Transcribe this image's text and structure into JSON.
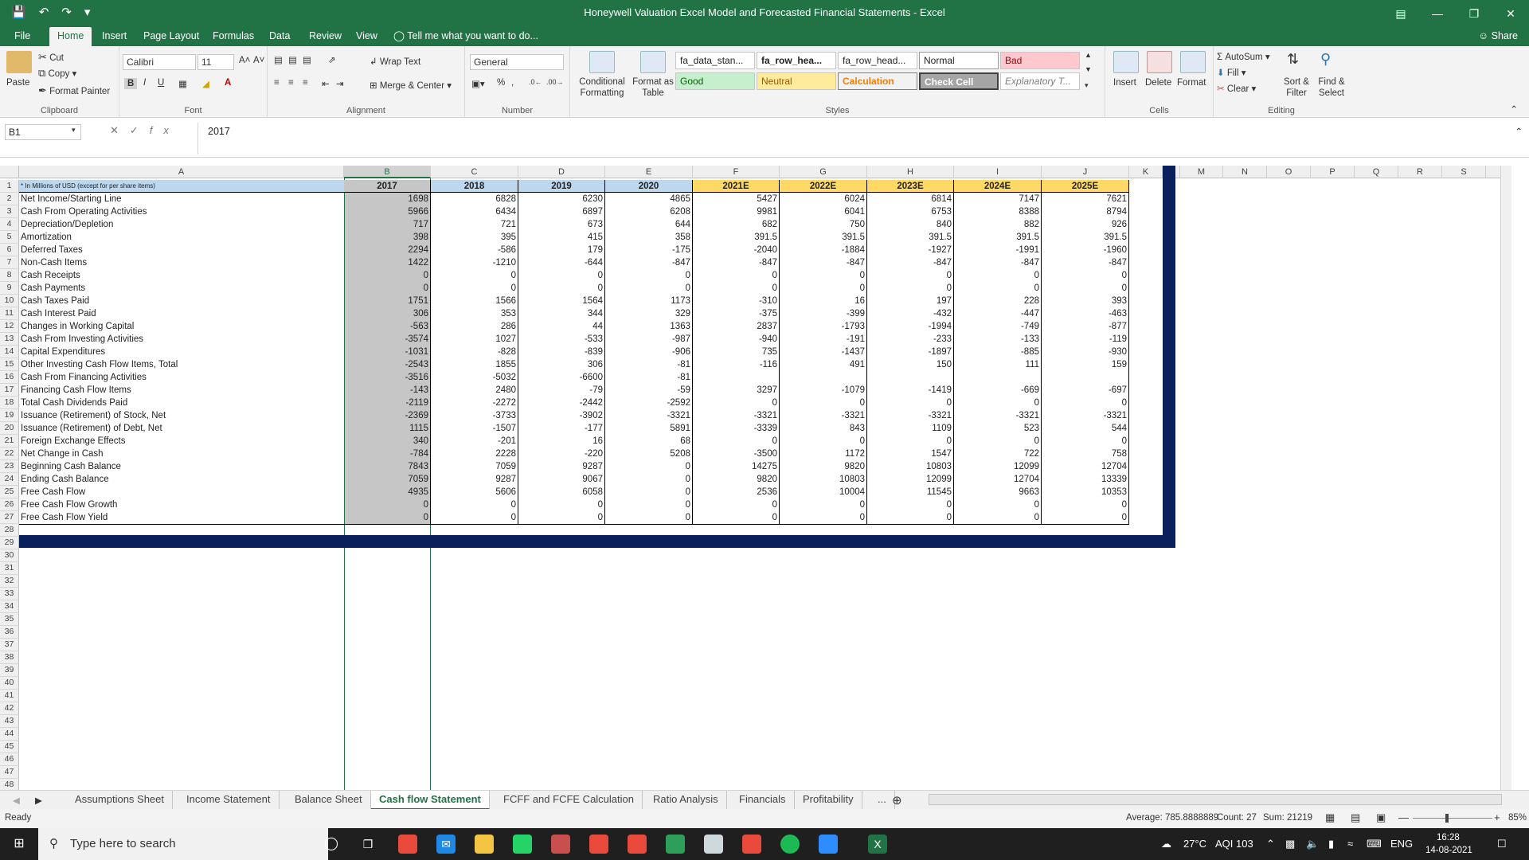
{
  "window": {
    "title": "Honeywell Valuation Excel Model and Forecasted Financial Statements - Excel",
    "qat": [
      "save-icon",
      "undo-icon",
      "redo-icon",
      "customize-icon"
    ],
    "controls": [
      "ribbon-display-icon",
      "minimize-icon",
      "restore-icon",
      "close-icon"
    ]
  },
  "ribbon_tabs": [
    "File",
    "Home",
    "Insert",
    "Page Layout",
    "Formulas",
    "Data",
    "Review",
    "View"
  ],
  "active_tab": "Home",
  "tell_me": "Tell me what you want to do...",
  "share_label": "Share",
  "clipboard": {
    "paste": "Paste",
    "cut": "Cut",
    "copy": "Copy",
    "format_painter": "Format Painter",
    "label": "Clipboard"
  },
  "font": {
    "name": "Calibri",
    "size": "11",
    "label": "Font"
  },
  "alignment": {
    "wrap_text": "Wrap Text",
    "merge_center": "Merge & Center",
    "label": "Alignment"
  },
  "number": {
    "format": "General",
    "label": "Number"
  },
  "styles": {
    "conditional_formatting": "Conditional Formatting",
    "format_as_table": "Format as Table",
    "cells": [
      "fa_data_stan...",
      "fa_row_hea...",
      "fa_row_head...",
      "Normal",
      "Bad",
      "Good",
      "Neutral",
      "Calculation",
      "Check Cell",
      "Explanatory T..."
    ],
    "label": "Styles"
  },
  "cells_group": {
    "insert": "Insert",
    "delete": "Delete",
    "format": "Format",
    "label": "Cells"
  },
  "editing": {
    "autosum": "AutoSum",
    "fill": "Fill",
    "clear": "Clear",
    "sort_filter": "Sort & Filter",
    "find_select": "Find & Select",
    "label": "Editing"
  },
  "formula_bar": {
    "name_box": "B1",
    "content": "2017"
  },
  "columns": [
    "A",
    "B",
    "C",
    "D",
    "E",
    "F",
    "G",
    "H",
    "I",
    "J",
    "K",
    "L",
    "M",
    "N",
    "O",
    "P",
    "Q",
    "R",
    "S",
    "T"
  ],
  "row_numbers": [
    "1",
    "2",
    "3",
    "4",
    "5",
    "6",
    "7",
    "8",
    "9",
    "10",
    "11",
    "12",
    "13",
    "14",
    "15",
    "16",
    "17",
    "18",
    "19",
    "20",
    "21",
    "22",
    "23",
    "24",
    "25",
    "26",
    "27",
    "28",
    "29",
    "30",
    "31",
    "32",
    "33",
    "34",
    "35",
    "36",
    "37",
    "38",
    "39",
    "40",
    "41",
    "42",
    "43",
    "44",
    "45",
    "46",
    "47",
    "48"
  ],
  "sheet": {
    "header_label": "* In Millions of USD (except for per share items)",
    "years": [
      "2017",
      "2018",
      "2019",
      "2020",
      "2021E",
      "2022E",
      "2023E",
      "2024E",
      "2025E"
    ],
    "rows": [
      {
        "label": "Net Income/Starting Line",
        "values": [
          "1698",
          "6828",
          "6230",
          "4865",
          "5427",
          "6024",
          "6814",
          "7147",
          "7621"
        ]
      },
      {
        "label": "Cash From Operating Activities",
        "values": [
          "5966",
          "6434",
          "6897",
          "6208",
          "9981",
          "6041",
          "6753",
          "8388",
          "8794"
        ]
      },
      {
        "label": "Depreciation/Depletion",
        "values": [
          "717",
          "721",
          "673",
          "644",
          "682",
          "750",
          "840",
          "882",
          "926"
        ]
      },
      {
        "label": "Amortization",
        "values": [
          "398",
          "395",
          "415",
          "358",
          "391.5",
          "391.5",
          "391.5",
          "391.5",
          "391.5"
        ]
      },
      {
        "label": "Deferred Taxes",
        "values": [
          "2294",
          "-586",
          "179",
          "-175",
          "-2040",
          "-1884",
          "-1927",
          "-1991",
          "-1960"
        ]
      },
      {
        "label": "Non-Cash Items",
        "values": [
          "1422",
          "-1210",
          "-644",
          "-847",
          "-847",
          "-847",
          "-847",
          "-847",
          "-847"
        ]
      },
      {
        "label": "Cash Receipts",
        "values": [
          "0",
          "0",
          "0",
          "0",
          "0",
          "0",
          "0",
          "0",
          "0"
        ]
      },
      {
        "label": "Cash Payments",
        "values": [
          "0",
          "0",
          "0",
          "0",
          "0",
          "0",
          "0",
          "0",
          "0"
        ]
      },
      {
        "label": "Cash Taxes Paid",
        "values": [
          "1751",
          "1566",
          "1564",
          "1173",
          "-310",
          "16",
          "197",
          "228",
          "393"
        ]
      },
      {
        "label": "Cash Interest Paid",
        "values": [
          "306",
          "353",
          "344",
          "329",
          "-375",
          "-399",
          "-432",
          "-447",
          "-463"
        ]
      },
      {
        "label": "Changes in Working Capital",
        "values": [
          "-563",
          "286",
          "44",
          "1363",
          "2837",
          "-1793",
          "-1994",
          "-749",
          "-877"
        ]
      },
      {
        "label": "Cash From Investing Activities",
        "values": [
          "-3574",
          "1027",
          "-533",
          "-987",
          "-940",
          "-191",
          "-233",
          "-133",
          "-119"
        ]
      },
      {
        "label": "Capital Expenditures",
        "values": [
          "-1031",
          "-828",
          "-839",
          "-906",
          "735",
          "-1437",
          "-1897",
          "-885",
          "-930"
        ]
      },
      {
        "label": "Other Investing Cash Flow Items, Total",
        "values": [
          "-2543",
          "1855",
          "306",
          "-81",
          "-116",
          "491",
          "150",
          "111",
          "159"
        ]
      },
      {
        "label": "Cash From Financing Activities",
        "values": [
          "-3516",
          "-5032",
          "-6600",
          "-81",
          "",
          "",
          "",
          "",
          ""
        ]
      },
      {
        "label": "Financing Cash Flow Items",
        "values": [
          "-143",
          "2480",
          "-79",
          "-59",
          "3297",
          "-1079",
          "-1419",
          "-669",
          "-697"
        ]
      },
      {
        "label": "Total Cash Dividends Paid",
        "values": [
          "-2119",
          "-2272",
          "-2442",
          "-2592",
          "0",
          "0",
          "0",
          "0",
          "0"
        ]
      },
      {
        "label": "Issuance (Retirement) of Stock, Net",
        "values": [
          "-2369",
          "-3733",
          "-3902",
          "-3321",
          "-3321",
          "-3321",
          "-3321",
          "-3321",
          "-3321"
        ]
      },
      {
        "label": "Issuance (Retirement) of Debt, Net",
        "values": [
          "1115",
          "-1507",
          "-177",
          "5891",
          "-3339",
          "843",
          "1109",
          "523",
          "544"
        ]
      },
      {
        "label": "Foreign Exchange Effects",
        "values": [
          "340",
          "-201",
          "16",
          "68",
          "0",
          "0",
          "0",
          "0",
          "0"
        ]
      },
      {
        "label": "Net Change in Cash",
        "values": [
          "-784",
          "2228",
          "-220",
          "5208",
          "-3500",
          "1172",
          "1547",
          "722",
          "758"
        ]
      },
      {
        "label": "Beginning Cash Balance",
        "values": [
          "7843",
          "7059",
          "9287",
          "0",
          "14275",
          "9820",
          "10803",
          "12099",
          "12704"
        ]
      },
      {
        "label": "Ending Cash Balance",
        "values": [
          "7059",
          "9287",
          "9067",
          "0",
          "9820",
          "10803",
          "12099",
          "12704",
          "13339"
        ]
      },
      {
        "label": "Free Cash Flow",
        "values": [
          "4935",
          "5606",
          "6058",
          "0",
          "2536",
          "10004",
          "11545",
          "9663",
          "10353"
        ]
      },
      {
        "label": "Free Cash Flow Growth",
        "values": [
          "0",
          "0",
          "0",
          "0",
          "0",
          "0",
          "0",
          "0",
          "0"
        ]
      },
      {
        "label": "Free Cash Flow Yield",
        "values": [
          "0",
          "0",
          "0",
          "0",
          "0",
          "0",
          "0",
          "0",
          "0"
        ]
      }
    ]
  },
  "sheet_tabs": [
    "Assumptions Sheet",
    "Income Statement",
    "Balance Sheet",
    "Cash flow Statement",
    "FCFF and FCFE Calculation",
    "Ratio Analysis",
    "Financials",
    "Profitability",
    "..."
  ],
  "active_sheet": "Cash flow Statement",
  "status": {
    "ready": "Ready",
    "average": "Average: 785.8888889",
    "count": "Count: 27",
    "sum": "Sum: 21219",
    "zoom": "85%"
  },
  "taskbar": {
    "search_placeholder": "Type here to search",
    "weather": "27°C",
    "aqi": "AQI 103",
    "lang": "ENG",
    "time": "16:28",
    "date": "14-08-2021"
  },
  "colors": {
    "excel_green": "#217346",
    "header_blue": "#bdd7ee",
    "forecast_yellow": "#ffd966",
    "frame_navy": "#0b1f5c"
  }
}
